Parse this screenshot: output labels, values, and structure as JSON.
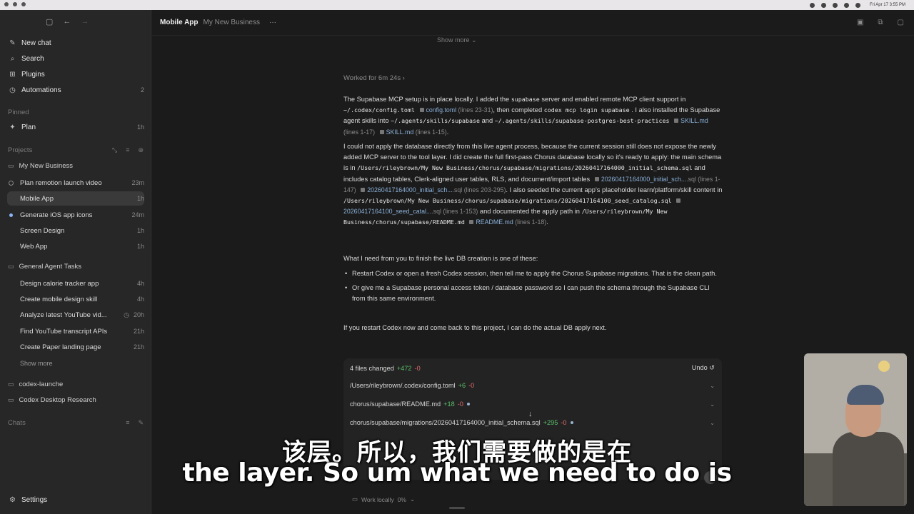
{
  "menubar": {
    "clock": "Fri Apr 17 3:55 PM"
  },
  "sidebar": {
    "nav": [
      {
        "label": "New chat",
        "icon": "compose-icon"
      },
      {
        "label": "Search",
        "icon": "search-icon"
      },
      {
        "label": "Plugins",
        "icon": "grid-icon"
      },
      {
        "label": "Automations",
        "icon": "clock-icon",
        "badge": "2"
      }
    ],
    "pinned_label": "Pinned",
    "pinned": [
      {
        "label": "Plan",
        "time": "1h"
      }
    ],
    "projects_label": "Projects",
    "project1": "My New Business",
    "project1_threads": [
      {
        "label": "Plan remotion launch video",
        "time": "23m"
      },
      {
        "label": "Mobile App",
        "time": "1h"
      },
      {
        "label": "Generate iOS app icons",
        "time": "24m"
      },
      {
        "label": "Screen Design",
        "time": "1h"
      },
      {
        "label": "Web App",
        "time": "1h"
      }
    ],
    "project2": "General Agent Tasks",
    "project2_threads": [
      {
        "label": "Design calorie tracker app",
        "time": "4h"
      },
      {
        "label": "Create mobile design skill",
        "time": "4h"
      },
      {
        "label": "Analyze latest YouTube vid...",
        "time": "20h"
      },
      {
        "label": "Find YouTube transcript APIs",
        "time": "21h"
      },
      {
        "label": "Create Paper landing page",
        "time": "21h"
      }
    ],
    "show_more": "Show more",
    "project3": "codex-launche",
    "project4": "Codex Desktop Research",
    "chats_label": "Chats",
    "settings": "Settings"
  },
  "topbar": {
    "title": "Mobile App",
    "subtitle": "My New Business",
    "more": "···"
  },
  "conversation": {
    "show_more": "Show more",
    "worked_for": "Worked for 6m 24s",
    "p1": {
      "t1": "The Supabase MCP setup is in place locally. I added the",
      "c1": "supabase",
      "t2": "server and enabled remote MCP client support in",
      "c2": "~/.codex/config.toml",
      "chip1_name": "config.toml",
      "chip1_lines": "(lines 23-31)",
      "t3": ", then completed",
      "c3": "codex mcp login supabase",
      "t4": ". I also installed the Supabase agent skills into",
      "c4": "~/.agents/skills/supabase",
      "t5": "and",
      "c5": "~/.agents/skills/supabase-postgres-best-practices",
      "chip2_name": "SKILL.md",
      "chip2_lines": "(lines 1-17)",
      "chip3_name": "SKILL.md",
      "chip3_lines": "(lines 1-15)",
      "t6": "."
    },
    "p2": {
      "t1": "I could not apply the database directly from this live agent process, because the current session still does not expose the newly added MCP server to the tool layer. I did create the full first-pass Chorus database locally so it's ready to apply: the main schema is in",
      "c1": "/Users/rileybrown/My New Business/chorus/supabase/migrations/20260417164000_initial_schema.sql",
      "t2": "and includes catalog tables, Clerk-aligned user tables, RLS, and document/import tables",
      "chip1_name": "20260417164000_initial_sch...",
      "chip1_lines": ".sql (lines 1-147)",
      "chip2_name": "20260417164000_initial_sch...",
      "chip2_lines": ".sql (lines 203-295)",
      "t3": ". I also seeded the current app's placeholder learn/platform/skill content in",
      "c2": "/Users/rileybrown/My New Business/chorus/supabase/migrations/20260417164100_seed_catalog.sql",
      "chip3_name": "20260417164100_seed_catal...",
      "chip3_lines": ".sql (lines 1-153)",
      "t4": "and documented the apply path in",
      "c3": "/Users/rileybrown/My New Business/chorus/supabase/README.md",
      "chip4_name": "README.md",
      "chip4_lines": "(lines 1-18)",
      "t5": "."
    },
    "p3": "What I need from you to finish the live DB creation is one of these:",
    "bullets": [
      "Restart Codex or open a fresh Codex session, then tell me to apply the Chorus Supabase migrations. That is the clean path.",
      "Or give me a Supabase personal access token / database password so I can push the schema through the Supabase CLI from this same environment."
    ],
    "p4": "If you restart Codex now and come back to this project, I can do the actual DB apply next."
  },
  "changes": {
    "summary": "4 files changed",
    "added": "+472",
    "removed": "-0",
    "undo": "Undo",
    "files": [
      {
        "path": "/Users/rileybrown/.codex/config.toml",
        "added": "+6",
        "removed": "-0"
      },
      {
        "path": "chorus/supabase/README.md",
        "added": "+18",
        "removed": "-0"
      },
      {
        "path": "chorus/supabase/migrations/20260417164000_initial_schema.sql",
        "added": "+295",
        "removed": "-0"
      }
    ]
  },
  "composer": {
    "mode": "Work locally",
    "pct": "0%"
  },
  "captions": {
    "chinese": "该层。所以，我们需要做的是在",
    "english": "the layer. So um what we need to do is"
  },
  "colors": {
    "accent_blue": "#8ab4f8",
    "added_green": "#5bbf6a",
    "removed_red": "#e06c6c"
  }
}
